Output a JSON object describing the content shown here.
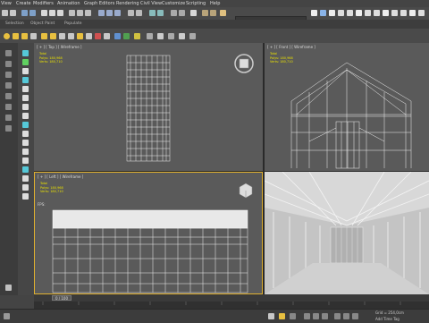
{
  "menubar": {
    "items": [
      "View",
      "Create",
      "Modifiers",
      "Animation",
      "Graph Editors",
      "Rendering",
      "Civil View",
      "Customize",
      "Scripting",
      "Help"
    ]
  },
  "toolbar": {
    "workspace_value": ""
  },
  "ribbon": {
    "tabs": [
      "Selection",
      "Object Paint",
      "Populate"
    ]
  },
  "viewports": {
    "top": {
      "label": "[ + ] [ Top ] [ Wireframe ]"
    },
    "front": {
      "label": "[ + ] [ Front ] [ Wireframe ]"
    },
    "left": {
      "label": "[ + ] [ Left ] [ Wireframe ]",
      "fps": "FPS:"
    }
  },
  "stats": {
    "total": "Total",
    "polys": "Polys:  180,968",
    "verts": "Verts:  180,710"
  },
  "timeslider": {
    "value": "0 / 100"
  },
  "status": {
    "grid": "Grid = 254,0cm",
    "add_time_tag": "Add Time Tag"
  },
  "colors": {
    "accent_yellow": "#e8e000",
    "active_border": "#e0b030",
    "viewport_bg": "#5a5a5a",
    "shaded_bg": "#b8b8b8",
    "wire": "#f0f0f0"
  }
}
